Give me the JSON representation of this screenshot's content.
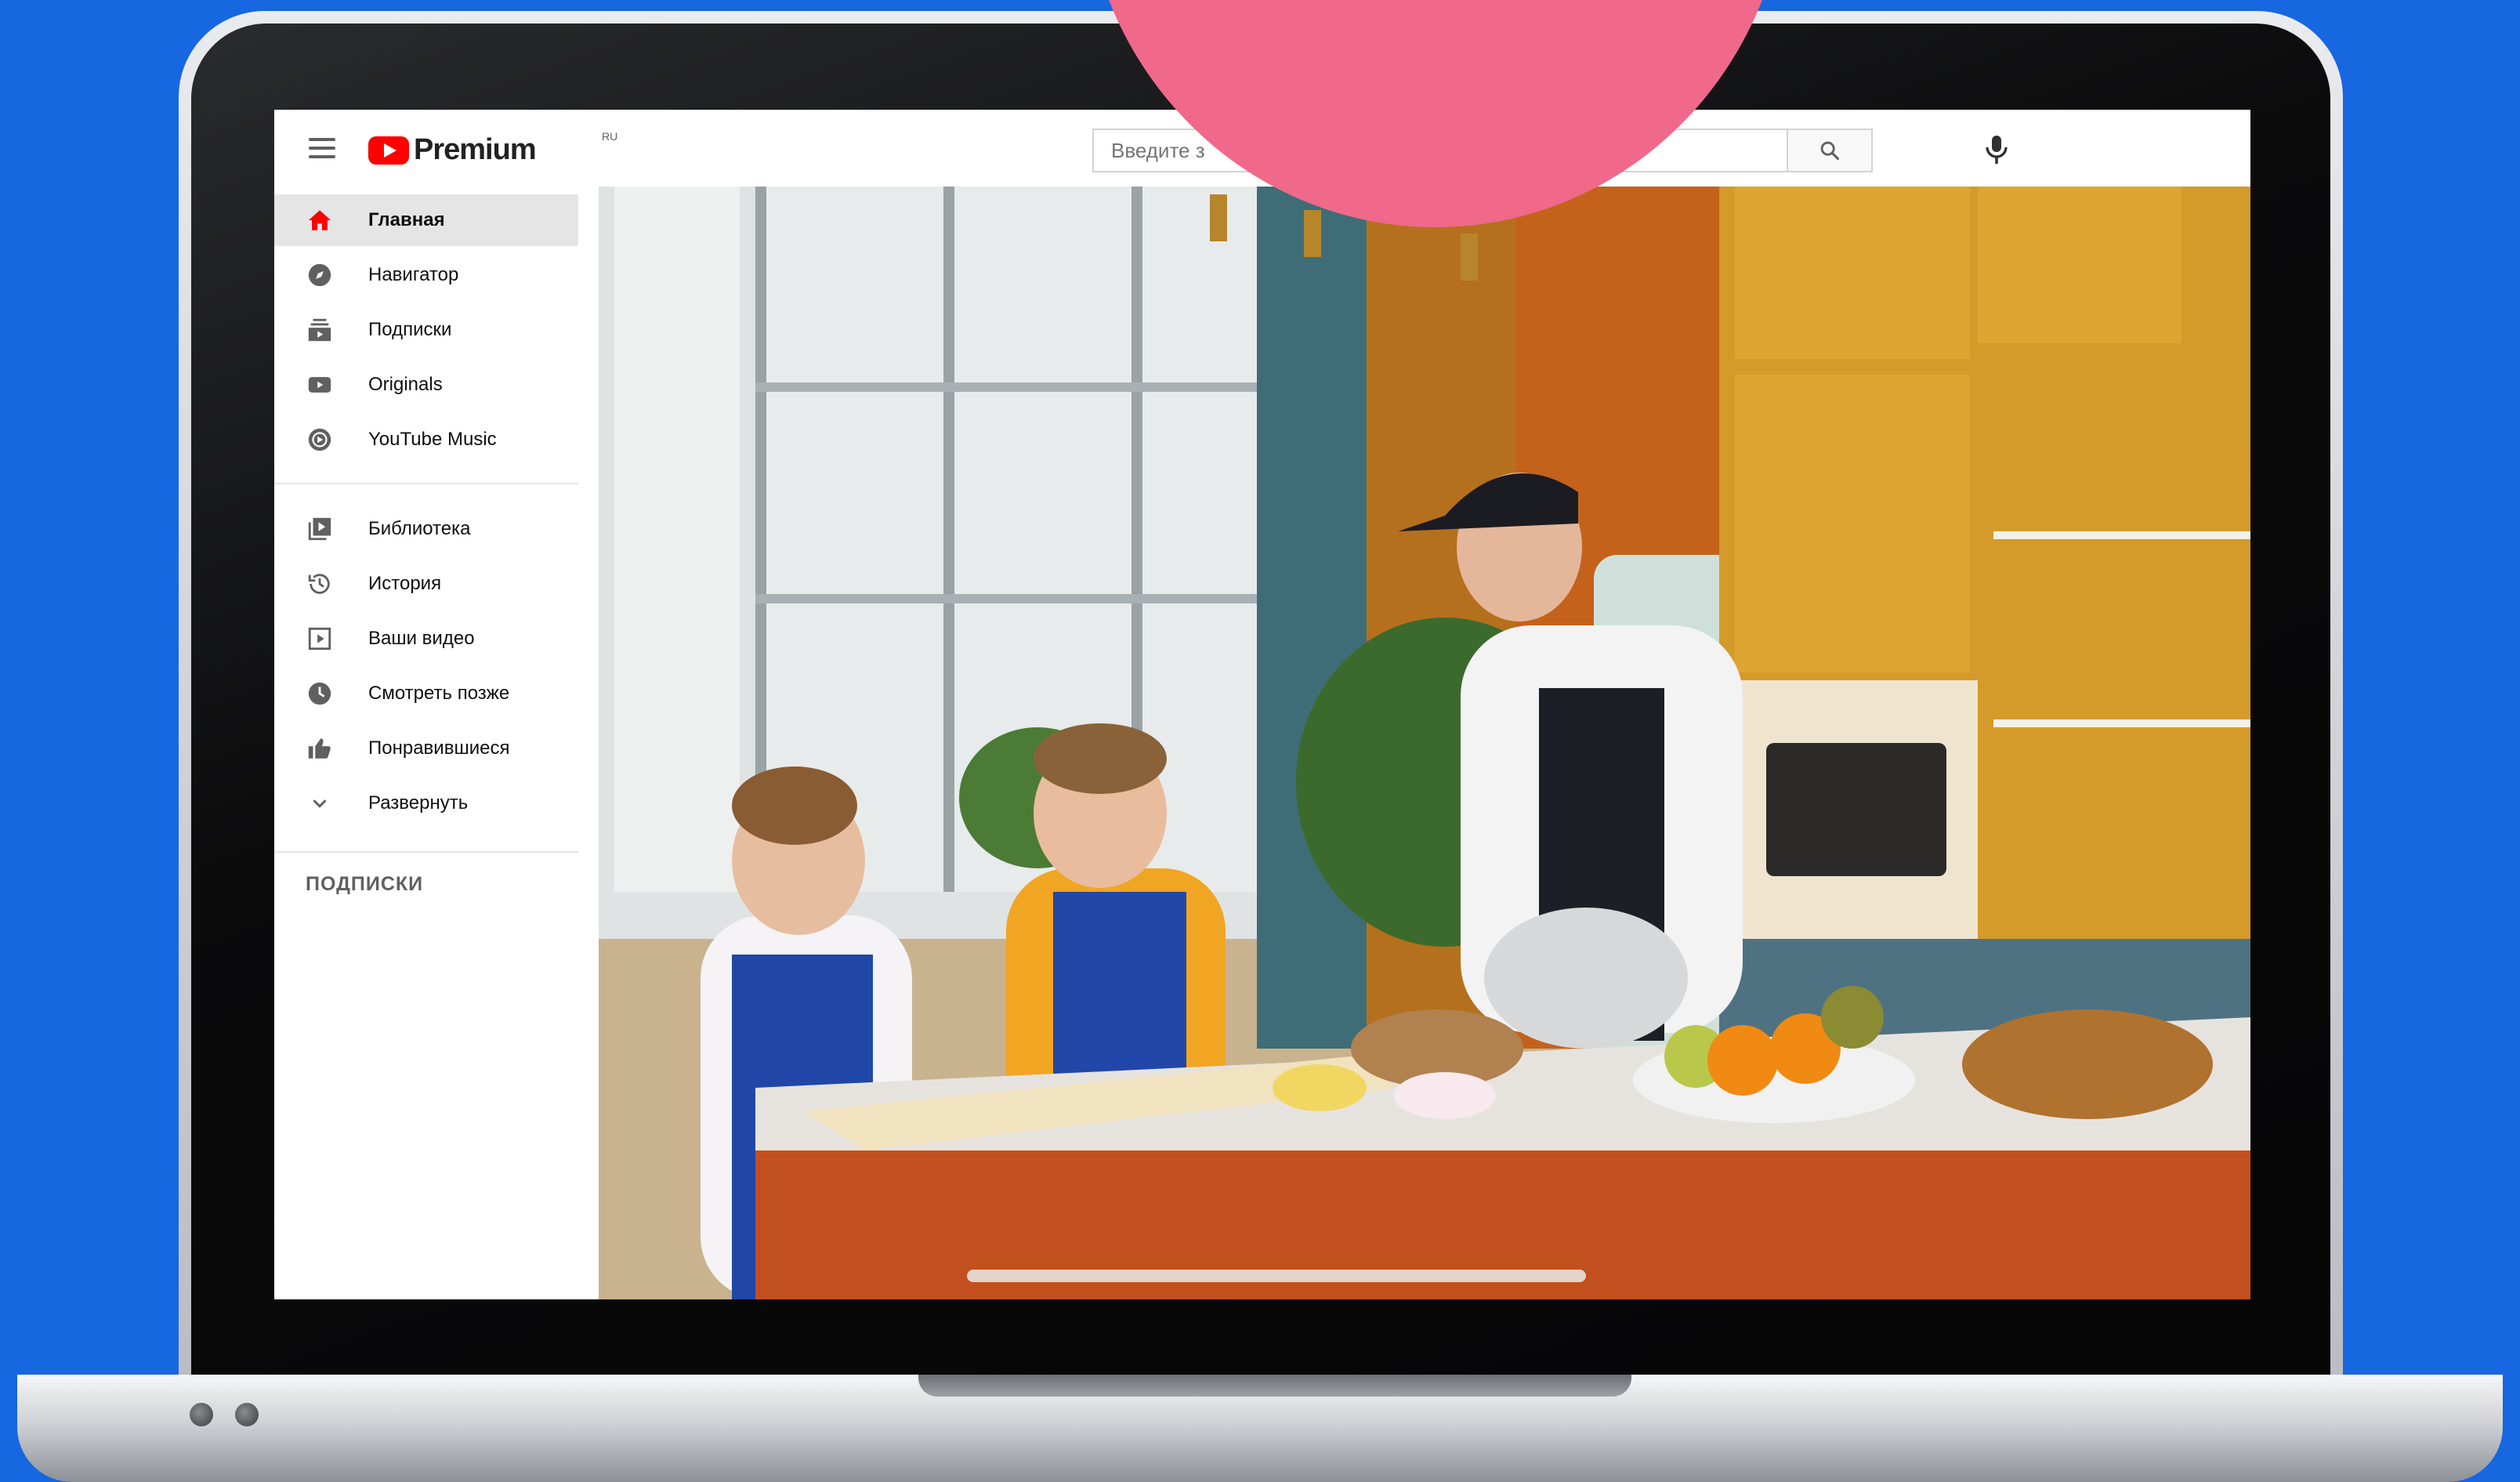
{
  "header": {
    "logo_text": "Premium",
    "logo_region": "RU",
    "search_placeholder": "Введите з"
  },
  "sidebar": {
    "primary": [
      {
        "label": "Главная",
        "icon": "home-icon",
        "active": true
      },
      {
        "label": "Навигатор",
        "icon": "compass-icon"
      },
      {
        "label": "Подписки",
        "icon": "subscriptions-icon"
      },
      {
        "label": "Originals",
        "icon": "originals-icon"
      },
      {
        "label": "YouTube Music",
        "icon": "music-icon"
      }
    ],
    "secondary": [
      {
        "label": "Библиотека",
        "icon": "library-icon"
      },
      {
        "label": "История",
        "icon": "history-icon"
      },
      {
        "label": "Ваши видео",
        "icon": "your-videos-icon"
      },
      {
        "label": "Смотреть позже",
        "icon": "watch-later-icon"
      },
      {
        "label": "Понравившиеся",
        "icon": "thumbs-up-icon"
      },
      {
        "label": "Развернуть",
        "icon": "chevron-down-icon"
      }
    ],
    "subscriptions_title": "ПОДПИСКИ"
  },
  "colors": {
    "background": "#1667e0",
    "brand_red": "#ff0000",
    "overlay_circle": "#f0688a"
  }
}
